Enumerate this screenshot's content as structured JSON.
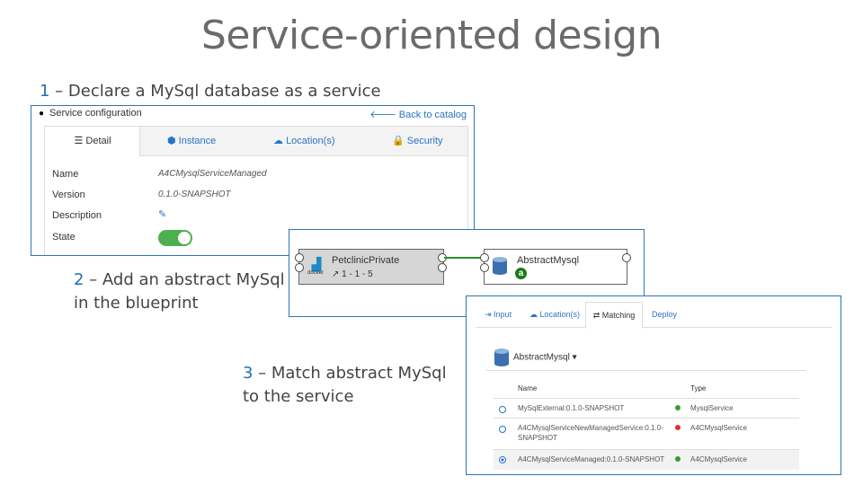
{
  "title": "Service-oriented design",
  "steps": [
    {
      "num": "1",
      "text": " – Declare a MySql database as a service"
    },
    {
      "num": "2",
      "line1": " – Add an abstract MySql",
      "line2": "in the blueprint"
    },
    {
      "num": "3",
      "line1": " – Match abstract MySql",
      "line2": "to the service"
    }
  ],
  "service_config": {
    "header": "Service configuration",
    "back_link": "Back to catalog",
    "tabs": [
      "Detail",
      "Instance",
      "Location(s)",
      "Security"
    ],
    "fields": [
      {
        "label": "Name",
        "value": "A4CMysqlServiceManaged"
      },
      {
        "label": "Version",
        "value": "0.1.0-SNAPSHOT"
      },
      {
        "label": "Description",
        "value": ""
      },
      {
        "label": "State",
        "value": ""
      }
    ],
    "state_on": true
  },
  "blueprint": {
    "node_a": {
      "name": "PetclinicPrivate",
      "version": "1 - 1 - 5",
      "logo_text": "docker"
    },
    "node_b": {
      "name": "AbstractMysql",
      "badge": "a"
    }
  },
  "matching": {
    "tabs": [
      "Input",
      "Location(s)",
      "Matching",
      "Deploy"
    ],
    "selected": "AbstractMysql",
    "columns": [
      "Name",
      "Type"
    ],
    "rows": [
      {
        "name": "MySqlExternal:0.1.0-SNAPSHOT",
        "status_color": "#3a9a3a",
        "type": "MysqlService"
      },
      {
        "name": "A4CMysqlServiceNewManagedService:0.1.0-",
        "name2": "SNAPSHOT",
        "status_color": "#d33",
        "type": "A4CMysqlService"
      },
      {
        "name": "A4CMysqlServiceManaged:0.1.0-SNAPSHOT",
        "status_color": "#3a9a3a",
        "type": "A4CMysqlService"
      }
    ]
  },
  "colors": {
    "accent": "#2e75b6",
    "link": "#2a74c4",
    "ok": "#4caf50"
  }
}
